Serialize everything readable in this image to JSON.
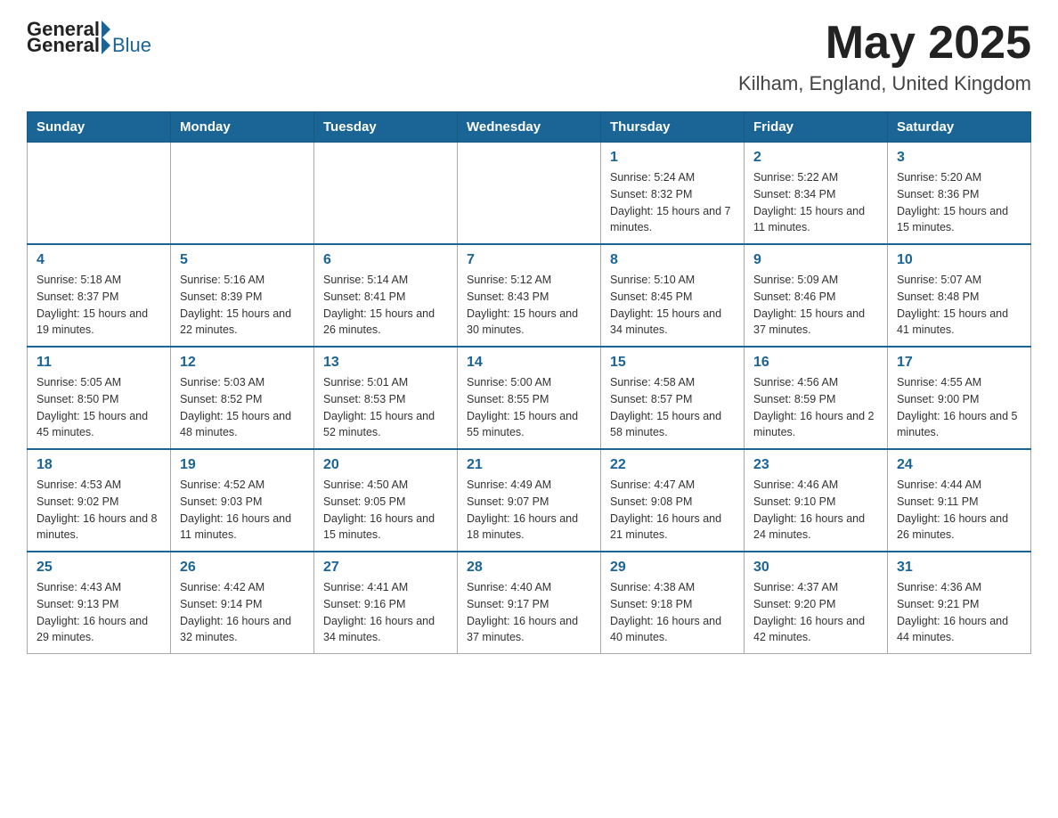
{
  "header": {
    "logo_general": "General",
    "logo_blue": "Blue",
    "month_title": "May 2025",
    "location": "Kilham, England, United Kingdom"
  },
  "days_of_week": [
    "Sunday",
    "Monday",
    "Tuesday",
    "Wednesday",
    "Thursday",
    "Friday",
    "Saturday"
  ],
  "weeks": [
    [
      {
        "day": "",
        "info": ""
      },
      {
        "day": "",
        "info": ""
      },
      {
        "day": "",
        "info": ""
      },
      {
        "day": "",
        "info": ""
      },
      {
        "day": "1",
        "info": "Sunrise: 5:24 AM\nSunset: 8:32 PM\nDaylight: 15 hours and 7 minutes."
      },
      {
        "day": "2",
        "info": "Sunrise: 5:22 AM\nSunset: 8:34 PM\nDaylight: 15 hours and 11 minutes."
      },
      {
        "day": "3",
        "info": "Sunrise: 5:20 AM\nSunset: 8:36 PM\nDaylight: 15 hours and 15 minutes."
      }
    ],
    [
      {
        "day": "4",
        "info": "Sunrise: 5:18 AM\nSunset: 8:37 PM\nDaylight: 15 hours and 19 minutes."
      },
      {
        "day": "5",
        "info": "Sunrise: 5:16 AM\nSunset: 8:39 PM\nDaylight: 15 hours and 22 minutes."
      },
      {
        "day": "6",
        "info": "Sunrise: 5:14 AM\nSunset: 8:41 PM\nDaylight: 15 hours and 26 minutes."
      },
      {
        "day": "7",
        "info": "Sunrise: 5:12 AM\nSunset: 8:43 PM\nDaylight: 15 hours and 30 minutes."
      },
      {
        "day": "8",
        "info": "Sunrise: 5:10 AM\nSunset: 8:45 PM\nDaylight: 15 hours and 34 minutes."
      },
      {
        "day": "9",
        "info": "Sunrise: 5:09 AM\nSunset: 8:46 PM\nDaylight: 15 hours and 37 minutes."
      },
      {
        "day": "10",
        "info": "Sunrise: 5:07 AM\nSunset: 8:48 PM\nDaylight: 15 hours and 41 minutes."
      }
    ],
    [
      {
        "day": "11",
        "info": "Sunrise: 5:05 AM\nSunset: 8:50 PM\nDaylight: 15 hours and 45 minutes."
      },
      {
        "day": "12",
        "info": "Sunrise: 5:03 AM\nSunset: 8:52 PM\nDaylight: 15 hours and 48 minutes."
      },
      {
        "day": "13",
        "info": "Sunrise: 5:01 AM\nSunset: 8:53 PM\nDaylight: 15 hours and 52 minutes."
      },
      {
        "day": "14",
        "info": "Sunrise: 5:00 AM\nSunset: 8:55 PM\nDaylight: 15 hours and 55 minutes."
      },
      {
        "day": "15",
        "info": "Sunrise: 4:58 AM\nSunset: 8:57 PM\nDaylight: 15 hours and 58 minutes."
      },
      {
        "day": "16",
        "info": "Sunrise: 4:56 AM\nSunset: 8:59 PM\nDaylight: 16 hours and 2 minutes."
      },
      {
        "day": "17",
        "info": "Sunrise: 4:55 AM\nSunset: 9:00 PM\nDaylight: 16 hours and 5 minutes."
      }
    ],
    [
      {
        "day": "18",
        "info": "Sunrise: 4:53 AM\nSunset: 9:02 PM\nDaylight: 16 hours and 8 minutes."
      },
      {
        "day": "19",
        "info": "Sunrise: 4:52 AM\nSunset: 9:03 PM\nDaylight: 16 hours and 11 minutes."
      },
      {
        "day": "20",
        "info": "Sunrise: 4:50 AM\nSunset: 9:05 PM\nDaylight: 16 hours and 15 minutes."
      },
      {
        "day": "21",
        "info": "Sunrise: 4:49 AM\nSunset: 9:07 PM\nDaylight: 16 hours and 18 minutes."
      },
      {
        "day": "22",
        "info": "Sunrise: 4:47 AM\nSunset: 9:08 PM\nDaylight: 16 hours and 21 minutes."
      },
      {
        "day": "23",
        "info": "Sunrise: 4:46 AM\nSunset: 9:10 PM\nDaylight: 16 hours and 24 minutes."
      },
      {
        "day": "24",
        "info": "Sunrise: 4:44 AM\nSunset: 9:11 PM\nDaylight: 16 hours and 26 minutes."
      }
    ],
    [
      {
        "day": "25",
        "info": "Sunrise: 4:43 AM\nSunset: 9:13 PM\nDaylight: 16 hours and 29 minutes."
      },
      {
        "day": "26",
        "info": "Sunrise: 4:42 AM\nSunset: 9:14 PM\nDaylight: 16 hours and 32 minutes."
      },
      {
        "day": "27",
        "info": "Sunrise: 4:41 AM\nSunset: 9:16 PM\nDaylight: 16 hours and 34 minutes."
      },
      {
        "day": "28",
        "info": "Sunrise: 4:40 AM\nSunset: 9:17 PM\nDaylight: 16 hours and 37 minutes."
      },
      {
        "day": "29",
        "info": "Sunrise: 4:38 AM\nSunset: 9:18 PM\nDaylight: 16 hours and 40 minutes."
      },
      {
        "day": "30",
        "info": "Sunrise: 4:37 AM\nSunset: 9:20 PM\nDaylight: 16 hours and 42 minutes."
      },
      {
        "day": "31",
        "info": "Sunrise: 4:36 AM\nSunset: 9:21 PM\nDaylight: 16 hours and 44 minutes."
      }
    ]
  ]
}
